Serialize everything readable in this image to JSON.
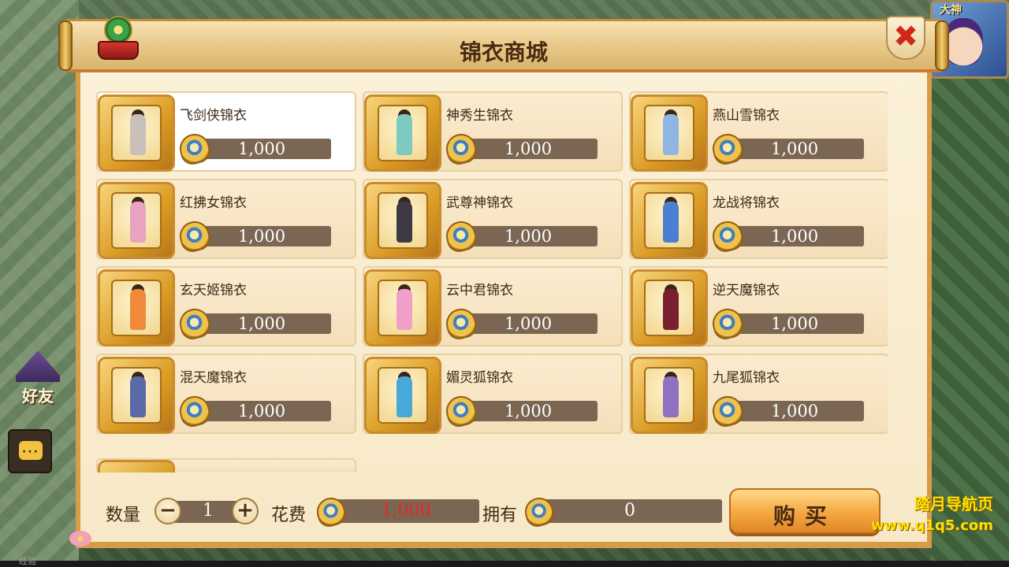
{
  "hud": {
    "player_name": "大神",
    "friend_label": "好友",
    "exp_label": "经验"
  },
  "window": {
    "title": "锦衣商城"
  },
  "items": [
    {
      "name": "飞剑侠锦衣",
      "price": "1,000",
      "color": "#c9c1b9"
    },
    {
      "name": "神秀生锦衣",
      "price": "1,000",
      "color": "#7ec9c0"
    },
    {
      "name": "燕山雪锦衣",
      "price": "1,000",
      "color": "#8fb6e0"
    },
    {
      "name": "红拂女锦衣",
      "price": "1,000",
      "color": "#e9a2c0"
    },
    {
      "name": "武尊神锦衣",
      "price": "1,000",
      "color": "#3d3a44"
    },
    {
      "name": "龙战将锦衣",
      "price": "1,000",
      "color": "#4a7fd1"
    },
    {
      "name": "玄天姬锦衣",
      "price": "1,000",
      "color": "#f08a3a"
    },
    {
      "name": "云中君锦衣",
      "price": "1,000",
      "color": "#f0a0c8"
    },
    {
      "name": "逆天魔锦衣",
      "price": "1,000",
      "color": "#7a2030"
    },
    {
      "name": "混天魔锦衣",
      "price": "1,000",
      "color": "#5a6aa8"
    },
    {
      "name": "媚灵狐锦衣",
      "price": "1,000",
      "color": "#48a9d8"
    },
    {
      "name": "九尾狐锦衣",
      "price": "1,000",
      "color": "#9070c0"
    }
  ],
  "footer": {
    "quantity_label": "数量",
    "minus_symbol": "−",
    "plus_symbol": "+",
    "quantity_value": "1",
    "cost_label": "花费",
    "cost_value": "1,000",
    "own_label": "拥有",
    "own_value": "0",
    "buy_label": "购买"
  },
  "close_symbol": "✖",
  "watermark": {
    "line1": "踏月导航页",
    "line2": "www.q1q5.com"
  }
}
